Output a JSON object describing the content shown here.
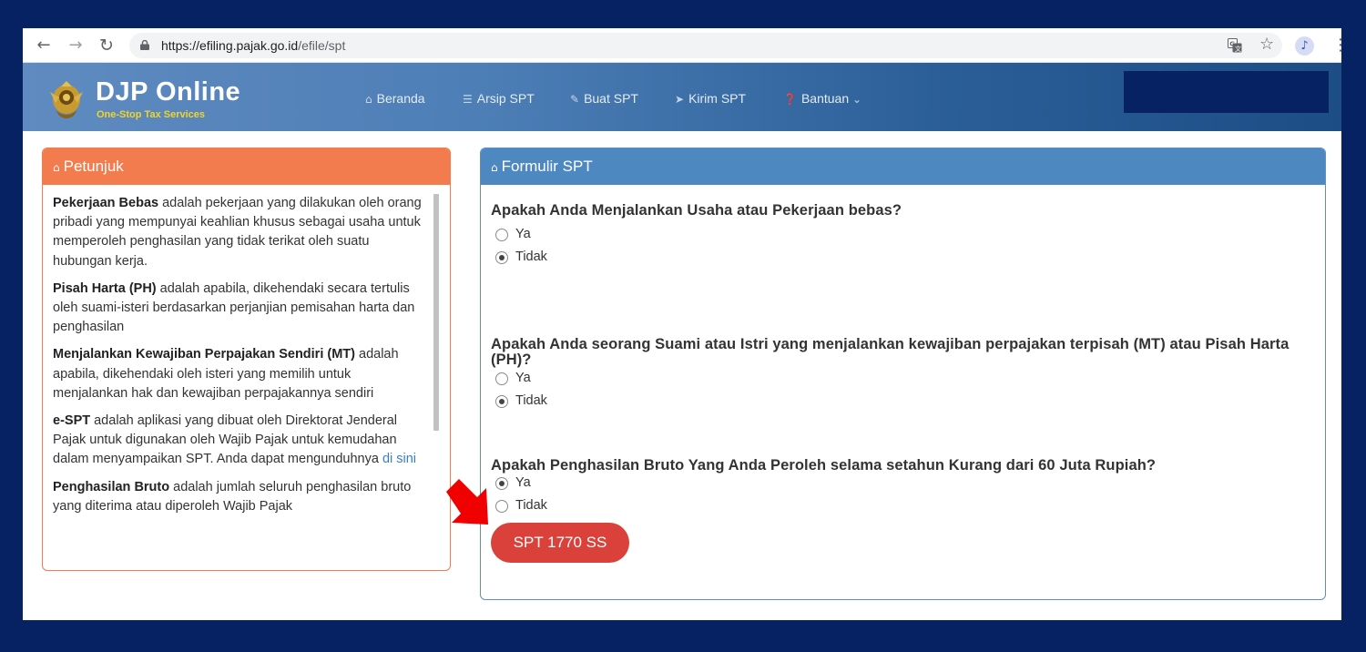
{
  "browser": {
    "url_host": "https://efiling.pajak.go.id",
    "url_path": "/efile/spt",
    "back_icon": "←",
    "forward_icon": "→",
    "reload_icon": "↻",
    "star_icon": "☆",
    "extension_icon": "♪",
    "menu_icon": "⋮"
  },
  "header": {
    "title": "DJP Online",
    "tagline": "One-Stop Tax Services",
    "nav": [
      {
        "icon": "⌂",
        "label": "Beranda"
      },
      {
        "icon": "☰",
        "label": "Arsip SPT"
      },
      {
        "icon": "✎",
        "label": "Buat SPT"
      },
      {
        "icon": "➤",
        "label": "Kirim SPT"
      },
      {
        "icon": "❓",
        "label": "Bantuan",
        "caret": "⌄"
      }
    ]
  },
  "petunjuk": {
    "heading_icon": "⌂",
    "heading": "Petunjuk",
    "items": [
      {
        "term": "Pekerjaan Bebas",
        "text": " adalah pekerjaan yang dilakukan oleh orang pribadi yang mempunyai keahlian khusus sebagai usaha untuk memperoleh penghasilan yang tidak terikat oleh suatu hubungan kerja."
      },
      {
        "term": "Pisah Harta (PH)",
        "text": " adalah apabila, dikehendaki secara tertulis oleh suami-isteri berdasarkan perjanjian pemisahan harta dan penghasilan"
      },
      {
        "term": "Menjalankan Kewajiban Perpajakan Sendiri (MT)",
        "text": " adalah apabila, dikehendaki oleh isteri yang memilih untuk menjalankan hak dan kewajiban perpajakannya sendiri"
      },
      {
        "term": "e-SPT",
        "text": " adalah aplikasi yang dibuat oleh Direktorat Jenderal Pajak untuk digunakan oleh Wajib Pajak untuk kemudahan dalam menyampaikan SPT. Anda dapat mengunduhnya ",
        "link": "di sini"
      },
      {
        "term": "Penghasilan Bruto",
        "text": " adalah jumlah seluruh penghasilan bruto yang diterima atau diperoleh Wajib Pajak"
      }
    ]
  },
  "formulir": {
    "heading_icon": "⌂",
    "heading": "Formulir SPT",
    "questions": [
      {
        "text": "Apakah Anda Menjalankan Usaha atau Pekerjaan bebas?",
        "options": [
          "Ya",
          "Tidak"
        ],
        "selected": "Tidak"
      },
      {
        "text": "Apakah Anda seorang Suami atau Istri yang menjalankan kewajiban perpajakan terpisah (MT) atau Pisah Harta (PH)?",
        "options": [
          "Ya",
          "Tidak"
        ],
        "selected": "Tidak"
      },
      {
        "text": "Apakah Penghasilan Bruto Yang Anda Peroleh selama setahun Kurang dari 60 Juta Rupiah?",
        "options": [
          "Ya",
          "Tidak"
        ],
        "selected": "Ya"
      }
    ],
    "submit_label": "SPT 1770 SS"
  },
  "colors": {
    "outer_background": "#062263",
    "petunjuk_accent": "#f27c4d",
    "formulir_accent": "#4d88c1",
    "button": "#d9413a",
    "arrow": "#f00000",
    "tagline": "#f2d427"
  }
}
